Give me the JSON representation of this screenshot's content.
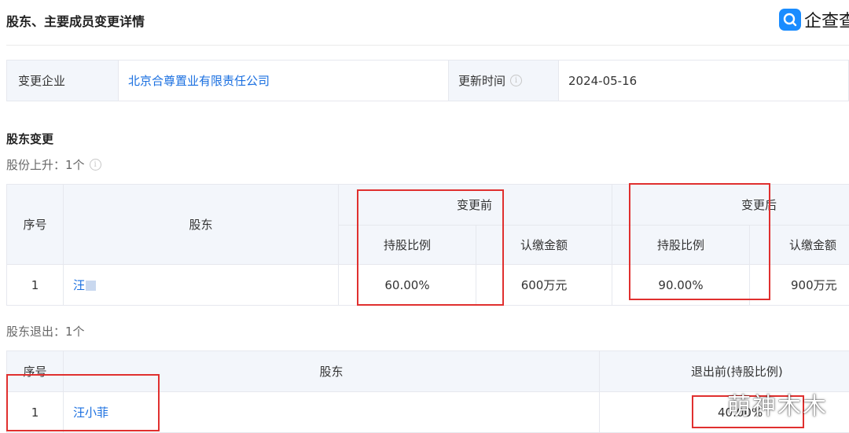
{
  "header": {
    "title": "股东、主要成员变更详情",
    "logo_text": "企查查",
    "logo_icon": "qcc-logo-icon"
  },
  "info": {
    "company_label": "变更企业",
    "company_name": "北京合尊置业有限责任公司",
    "update_label": "更新时间",
    "update_date": "2024-05-16"
  },
  "shareholder_change": {
    "section_title": "股东变更",
    "increase_label": "股份上升：1个",
    "table": {
      "col_index": "序号",
      "col_holder": "股东",
      "before_group": "变更前",
      "after_group": "变更后",
      "before_ratio": "持股比例",
      "before_amount": "认缴金额",
      "after_ratio": "持股比例",
      "after_amount": "认缴金额",
      "rows": [
        {
          "index": "1",
          "holder": "汪",
          "before_ratio": "60.00%",
          "before_amount": "600万元",
          "after_ratio": "90.00%",
          "after_amount": "900万元"
        }
      ]
    },
    "exit_label": "股东退出：1个",
    "exit_table": {
      "col_index": "序号",
      "col_holder": "股东",
      "col_before": "退出前(持股比例)",
      "rows": [
        {
          "index": "1",
          "holder": "汪小菲",
          "before_ratio": "40.00%"
        }
      ]
    }
  },
  "watermark": "萌神木木",
  "colors": {
    "link": "#1a6fe0",
    "highlight_box": "#e0302f",
    "header_bg": "#f3f6fb",
    "brand": "#1a8cff"
  }
}
